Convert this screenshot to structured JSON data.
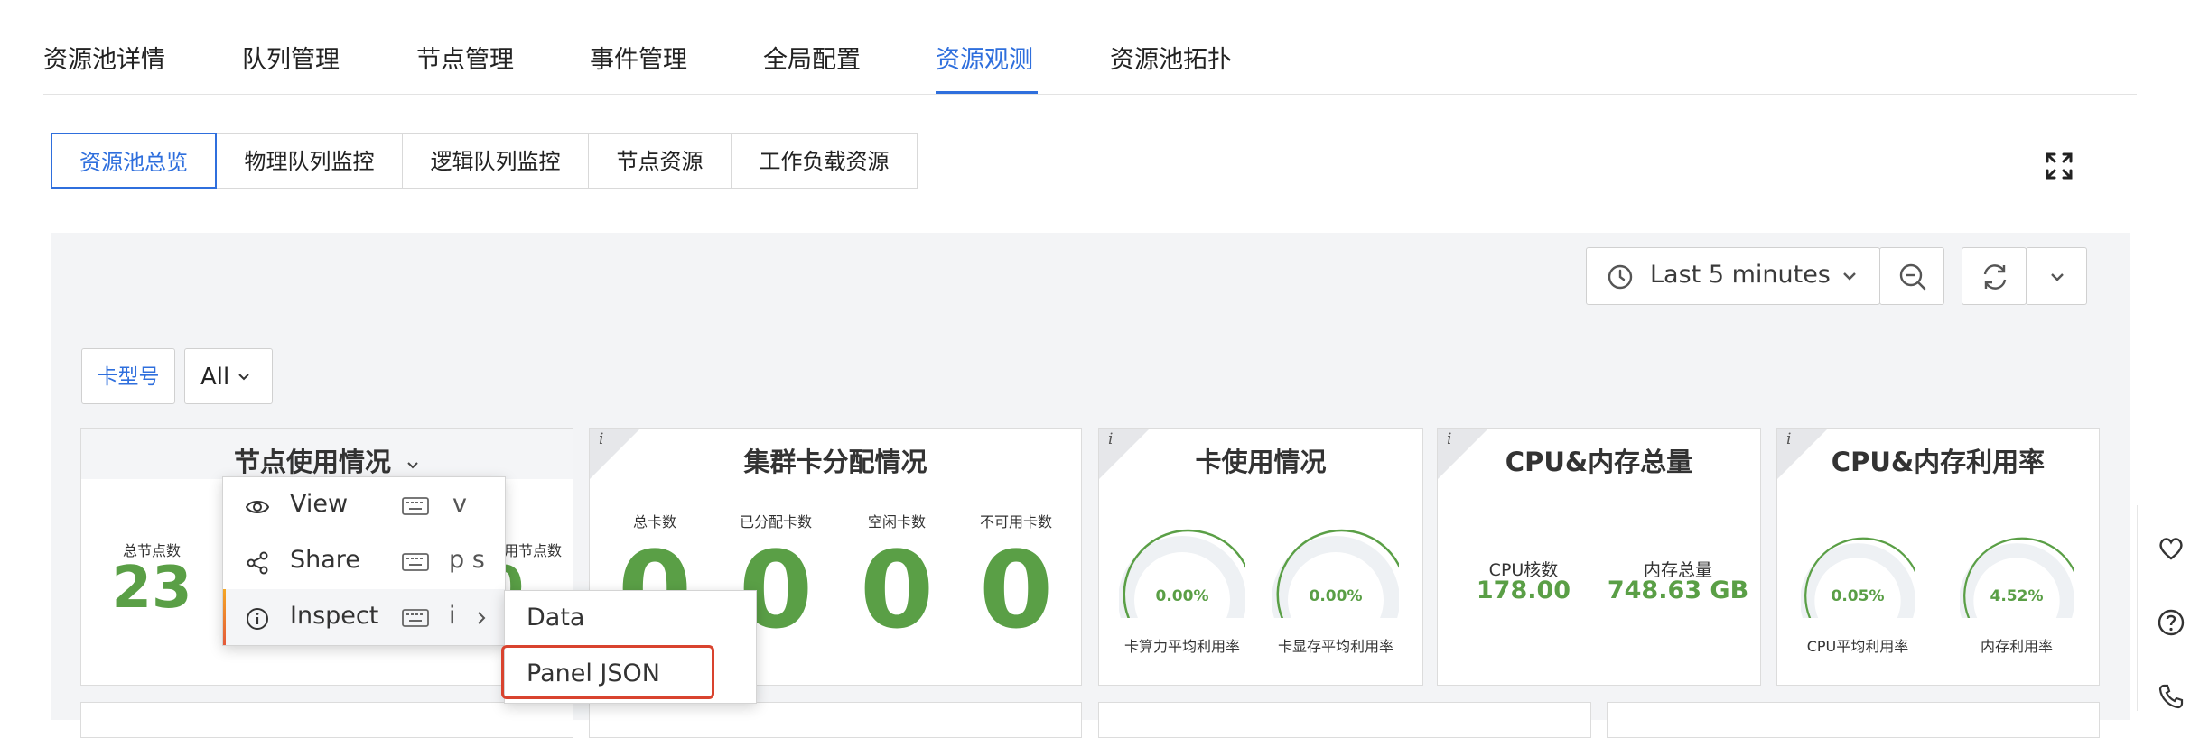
{
  "top_tabs": [
    {
      "label": "资源池详情",
      "active": false
    },
    {
      "label": "队列管理",
      "active": false
    },
    {
      "label": "节点管理",
      "active": false
    },
    {
      "label": "事件管理",
      "active": false
    },
    {
      "label": "全局配置",
      "active": false
    },
    {
      "label": "资源观测",
      "active": true
    },
    {
      "label": "资源池拓扑",
      "active": false
    }
  ],
  "sub_tabs": [
    {
      "label": "资源池总览",
      "active": true
    },
    {
      "label": "物理队列监控",
      "active": false
    },
    {
      "label": "逻辑队列监控",
      "active": false
    },
    {
      "label": "节点资源",
      "active": false
    },
    {
      "label": "工作负载资源",
      "active": false
    }
  ],
  "toolbar": {
    "time_range": "Last 5 minutes"
  },
  "filters": {
    "card_type_label": "卡型号",
    "card_type_value": "All"
  },
  "panels": {
    "node_usage": {
      "title": "节点使用情况",
      "total_nodes_label": "总节点数",
      "total_nodes_value": "23",
      "partial_label": "用节点数",
      "partial_value": "0"
    },
    "cluster_card_alloc": {
      "title": "集群卡分配情况",
      "stats": [
        {
          "label": "总卡数",
          "value": "0"
        },
        {
          "label": "已分配卡数",
          "value": "0"
        },
        {
          "label": "空闲卡数",
          "value": "0"
        },
        {
          "label": "不可用卡数",
          "value": "0"
        }
      ]
    },
    "card_usage": {
      "title": "卡使用情况",
      "gauges": [
        {
          "label": "卡算力平均利用率",
          "value": "0.00%",
          "fraction": 0.0
        },
        {
          "label": "卡显存平均利用率",
          "value": "0.00%",
          "fraction": 0.0
        }
      ]
    },
    "cpu_mem_total": {
      "title": "CPU&内存总量",
      "items": [
        {
          "label": "CPU核数",
          "value": "178.00"
        },
        {
          "label": "内存总量",
          "value": "748.63 GB"
        }
      ]
    },
    "cpu_mem_util": {
      "title": "CPU&内存利用率",
      "gauges": [
        {
          "label": "CPU平均利用率",
          "value": "0.05%",
          "fraction": 0.0005
        },
        {
          "label": "内存利用率",
          "value": "4.52%",
          "fraction": 0.0452
        }
      ]
    }
  },
  "context_menu": {
    "items": [
      {
        "label": "View",
        "shortcut": "v",
        "icon": "eye-icon"
      },
      {
        "label": "Share",
        "shortcut": "p s",
        "icon": "share-icon"
      },
      {
        "label": "Inspect",
        "shortcut": "i",
        "icon": "info-icon"
      }
    ],
    "submenu": {
      "items": [
        {
          "label": "Data"
        },
        {
          "label": "Panel JSON"
        }
      ]
    }
  },
  "colors": {
    "accent": "#2f6fdd",
    "value_green": "#5a9f46",
    "highlight_red": "#d9432e"
  }
}
